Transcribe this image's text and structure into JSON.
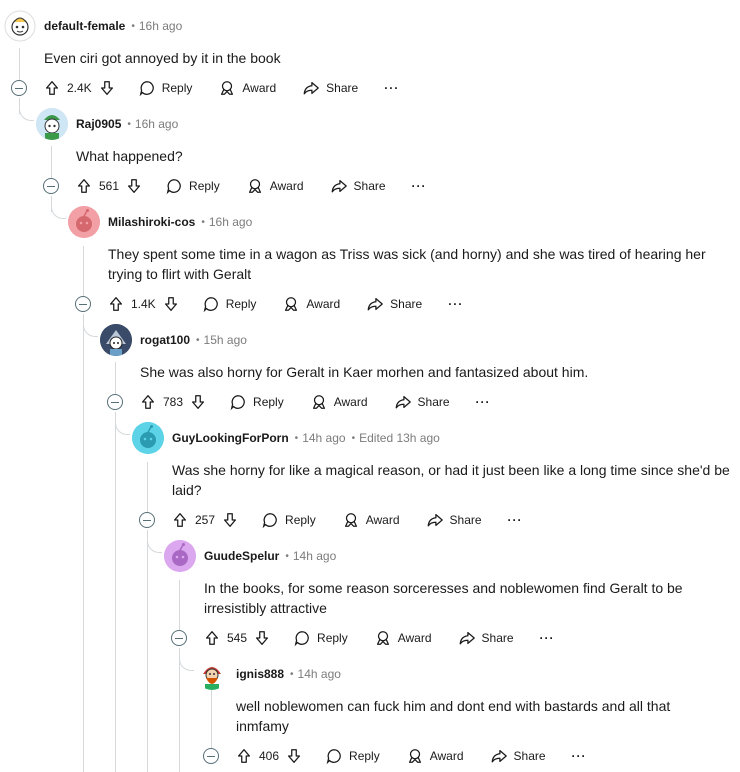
{
  "comments": [
    {
      "author": "default-female",
      "meta": "16h ago",
      "body": "Even ciri got annoyed by it in the book",
      "score": "2.4K",
      "avatar_color": "#ffffff"
    },
    {
      "author": "Raj0905",
      "meta": "16h ago",
      "body": "What happened?",
      "score": "561",
      "avatar_color": "#cfe6f5"
    },
    {
      "author": "Milashiroki-cos",
      "meta": "16h ago",
      "body": "They spent some time in a wagon as Triss was sick (and horny) and she was tired of hearing her trying to flirt with Geralt",
      "score": "1.4K",
      "avatar_color": "#f2a0a6"
    },
    {
      "author": "rogat100",
      "meta": "15h ago",
      "body": "She was also horny for Geralt in Kaer morhen and fantasized about him.",
      "score": "783",
      "avatar_color": "#3a4b6a"
    },
    {
      "author": "GuyLookingForPorn",
      "meta": "14h ago",
      "edited": "Edited 13h ago",
      "body": "Was she horny for like a magical reason, or had it just been like a long time since she'd be laid?",
      "score": "257",
      "avatar_color": "#5dd3e8"
    },
    {
      "author": "GuudeSpelur",
      "meta": "14h ago",
      "body": "In the books, for some reason sorceresses and noblewomen find Geralt to be irresistibly attractive",
      "score": "545",
      "avatar_color": "#dba8f0"
    },
    {
      "author": "ignis888",
      "meta": "14h ago",
      "body": "well noblewomen can fuck him and dont end with bastards and all that inmfamy",
      "score": "406",
      "avatar_color": "#ffffff"
    }
  ],
  "labels": {
    "reply": "Reply",
    "award": "Award",
    "share": "Share",
    "more": "···",
    "dot": "•"
  }
}
